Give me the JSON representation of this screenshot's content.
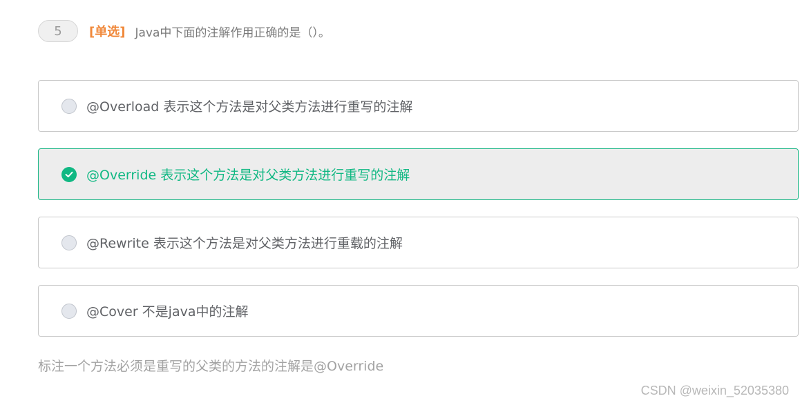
{
  "question": {
    "number": "5",
    "type": "[单选]",
    "text": "Java中下面的注解作用正确的是（）。"
  },
  "options": [
    {
      "label": "@Overload 表示这个方法是对父类方法进行重写的注解",
      "selected": false
    },
    {
      "label": "@Override 表示这个方法是对父类方法进行重写的注解",
      "selected": true
    },
    {
      "label": "@Rewrite 表示这个方法是对父类方法进行重载的注解",
      "selected": false
    },
    {
      "label": "@Cover 不是java中的注解",
      "selected": false
    }
  ],
  "analysis": "标注一个方法必须是重写的父类的方法的注解是@Override",
  "watermark": "CSDN @weixin_52035380",
  "colors": {
    "accent_green": "#11b883",
    "type_orange": "#f0883a"
  },
  "icons": {
    "selected_radio": "check-circle-icon",
    "unselected_radio": "empty-circle-icon"
  }
}
